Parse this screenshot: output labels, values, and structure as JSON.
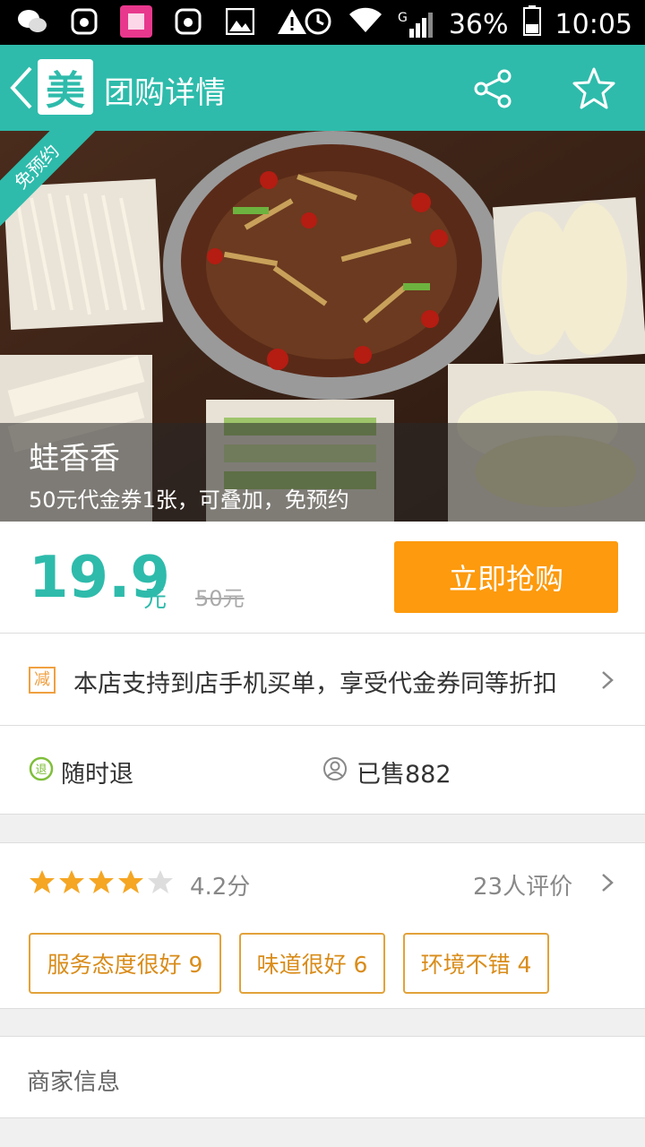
{
  "status_bar": {
    "battery": "36%",
    "time": "10:05",
    "network": "G"
  },
  "nav": {
    "logo_text": "美",
    "title": "团购详情"
  },
  "hero": {
    "badge": "免预约",
    "title": "蛙香香",
    "subtitle": "50元代金券1张，可叠加，免预约"
  },
  "price": {
    "current": "19.9",
    "unit": "元",
    "original": "50元",
    "buy_label": "立即抢购"
  },
  "discount": {
    "icon_text": "减",
    "text": "本店支持到店手机买单，享受代金券同等折扣"
  },
  "features": {
    "refund": "随时退",
    "sold": "已售882"
  },
  "rating": {
    "stars": 4.2,
    "score_text": "4.2分",
    "count_text": "23人评价"
  },
  "review_tags": [
    {
      "label": "服务态度很好 9"
    },
    {
      "label": "味道很好 6"
    },
    {
      "label": "环境不错 4"
    }
  ],
  "merchant": {
    "label": "商家信息"
  },
  "colors": {
    "brand": "#2ebbab",
    "buy": "#fd9a0d",
    "star": "#f5a623",
    "tag": "#e2a23a"
  }
}
